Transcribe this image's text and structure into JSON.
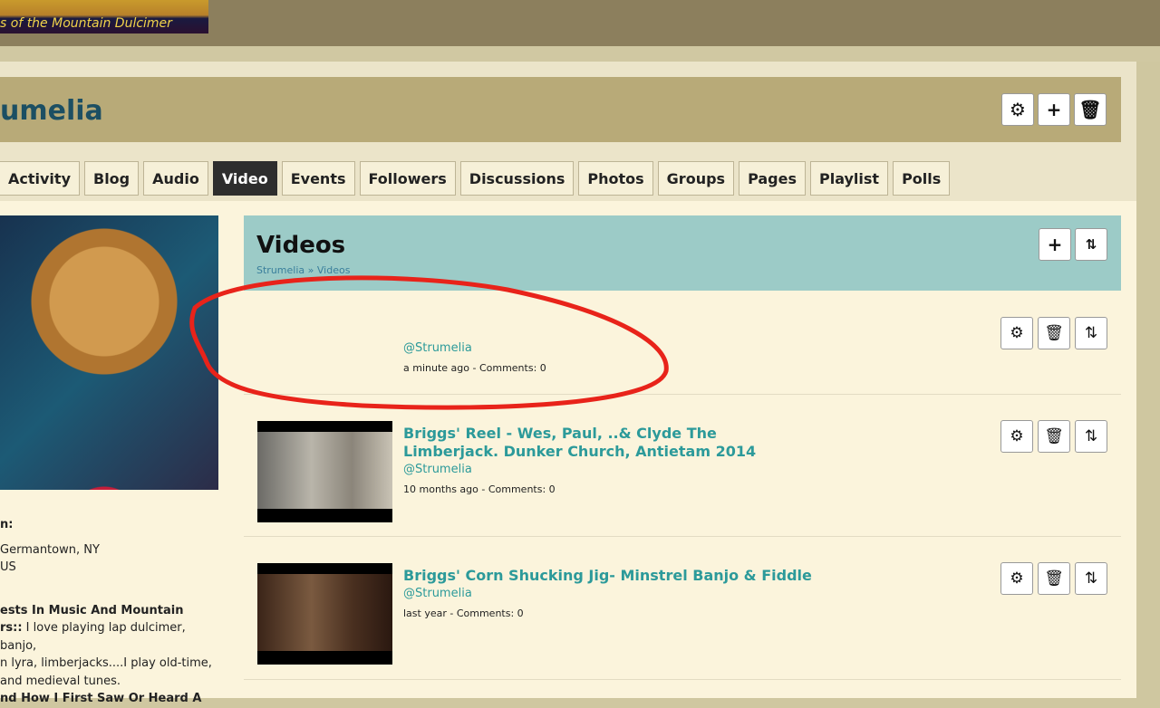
{
  "header": {
    "logo_text": "s of the Mountain Dulcimer"
  },
  "profile": {
    "name": "umelia",
    "actions": [
      "gear-icon",
      "plus-icon",
      "trash-icon"
    ]
  },
  "tabs": [
    {
      "label": "Activity"
    },
    {
      "label": "Blog"
    },
    {
      "label": "Audio"
    },
    {
      "label": "Video",
      "active": true
    },
    {
      "label": "Events"
    },
    {
      "label": "Followers"
    },
    {
      "label": "Discussions"
    },
    {
      "label": "Photos"
    },
    {
      "label": "Groups"
    },
    {
      "label": "Pages"
    },
    {
      "label": "Playlist"
    },
    {
      "label": "Polls"
    }
  ],
  "sidebar": {
    "location_label": "n:",
    "location_lines": [
      "Germantown, NY",
      "US"
    ],
    "interests_label_1": "ests In Music And Mountain",
    "interests_label_2": "rs::",
    "interests_text_1": " I love playing lap dulcimer, banjo,",
    "interests_text_2": "n lyra, limberjacks....I play old-time,",
    "interests_text_3": "and medieval tunes.",
    "how_label": "nd How I First Saw Or Heard A"
  },
  "videos": {
    "title": "Videos",
    "breadcrumb": {
      "parent": "Strumelia",
      "sep": " » ",
      "current": "Videos"
    },
    "items": [
      {
        "title": "",
        "user": "@Strumelia",
        "meta": "a minute ago - Comments: 0"
      },
      {
        "title": "Briggs' Reel - Wes, Paul, ..& Clyde The Limberjack. Dunker Church, Antietam 2014",
        "user": "@Strumelia",
        "meta": "10 months ago - Comments: 0"
      },
      {
        "title": "Briggs' Corn Shucking Jig- Minstrel Banjo & Fiddle",
        "user": "@Strumelia",
        "meta": "last year - Comments: 0"
      }
    ]
  },
  "annotation_color": "#e8231a"
}
